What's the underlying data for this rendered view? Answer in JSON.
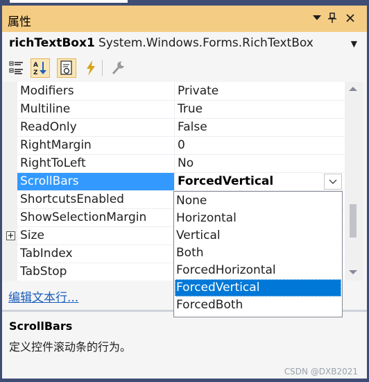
{
  "panel": {
    "title": "属性"
  },
  "object": {
    "name": "richTextBox1",
    "type": "System.Windows.Forms.RichTextBox"
  },
  "toolbar": {
    "buttons": [
      {
        "name": "categorized-icon",
        "active": false
      },
      {
        "name": "alphabetical-icon",
        "active": true
      },
      {
        "name": "properties-icon",
        "active": true
      },
      {
        "name": "events-icon",
        "active": false
      },
      {
        "name": "property-pages-icon",
        "active": false
      }
    ]
  },
  "properties": [
    {
      "name": "Modifiers",
      "value": "Private"
    },
    {
      "name": "Multiline",
      "value": "True"
    },
    {
      "name": "ReadOnly",
      "value": "False"
    },
    {
      "name": "RightMargin",
      "value": "0"
    },
    {
      "name": "RightToLeft",
      "value": "No"
    },
    {
      "name": "ScrollBars",
      "value": "ForcedVertical"
    },
    {
      "name": "ShortcutsEnabled",
      "value": ""
    },
    {
      "name": "ShowSelectionMargin",
      "value": ""
    },
    {
      "name": "Size",
      "value": ""
    },
    {
      "name": "TabIndex",
      "value": ""
    },
    {
      "name": "TabStop",
      "value": ""
    }
  ],
  "dropdown": {
    "options": [
      "None",
      "Horizontal",
      "Vertical",
      "Both",
      "ForcedHorizontal",
      "ForcedVertical",
      "ForcedBoth"
    ],
    "selected": "ForcedVertical"
  },
  "command_link": "编辑文本行...",
  "description": {
    "title": "ScrollBars",
    "text": "定义控件滚动条的行为。"
  },
  "watermark": "CSDN @DXB2021",
  "colors": {
    "title_bar": "#f5cc84",
    "selection": "#3399ff",
    "highlight": "#0078d7",
    "link": "#1a5ebd"
  }
}
